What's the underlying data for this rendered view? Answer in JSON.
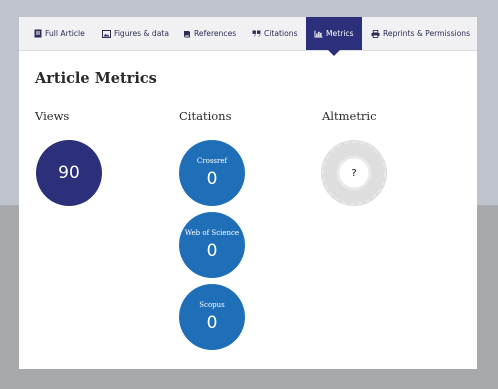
{
  "tabs": [
    {
      "label": "Full Article",
      "icon": "article-icon"
    },
    {
      "label": "Figures & data",
      "icon": "image-icon"
    },
    {
      "label": "References",
      "icon": "book-icon"
    },
    {
      "label": "Citations",
      "icon": "quote-icon"
    },
    {
      "label": "Metrics",
      "icon": "bar-chart-icon",
      "active": true
    },
    {
      "label": "Reprints & Permissions",
      "icon": "print-icon"
    }
  ],
  "main": {
    "title": "Article Metrics",
    "views": {
      "heading": "Views",
      "value": "90"
    },
    "citations": {
      "heading": "Citations",
      "items": [
        {
          "source": "Crossref",
          "value": "0"
        },
        {
          "source": "Web of Science",
          "value": "0"
        },
        {
          "source": "Scopus",
          "value": "0"
        }
      ]
    },
    "altmetric": {
      "heading": "Altmetric",
      "value": "?"
    }
  },
  "colors": {
    "nav_active": "#2c2f7a",
    "views_circle": "#2c2f7a",
    "citation_circle": "#1f6fb8",
    "page_bg": "#a8a9ad",
    "top_band": "#bfc3cb"
  }
}
